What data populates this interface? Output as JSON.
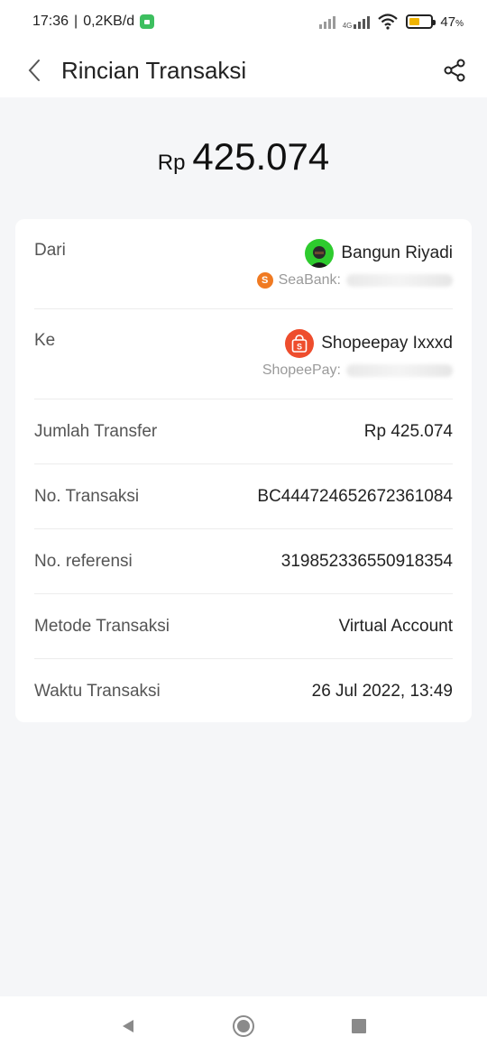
{
  "status_bar": {
    "time": "17:36",
    "separator": "|",
    "speed": "0,2KB/d",
    "net_label": "4G",
    "battery_percent": "47",
    "battery_percent_sign": "%",
    "battery_level": 0.47
  },
  "app_bar": {
    "title": "Rincian Transaksi",
    "back_icon": "chevron-left-icon",
    "share_icon": "share-icon"
  },
  "amount": {
    "currency": "Rp",
    "value": "425.074"
  },
  "details": {
    "from": {
      "label": "Dari",
      "name": "Bangun Riyadi",
      "account_label": "SeaBank:",
      "account_icon": "seabank-icon"
    },
    "to": {
      "label": "Ke",
      "name": "Shopeepay Ixxxd",
      "account_label": "ShopeePay:",
      "account_icon": "shopee-icon"
    },
    "rows": [
      {
        "label": "Jumlah Transfer",
        "value": "Rp 425.074"
      },
      {
        "label": "No. Transaksi",
        "value": "BC444724652672361084"
      },
      {
        "label": "No. referensi",
        "value": "319852336550918354"
      },
      {
        "label": "Metode Transaksi",
        "value": "Virtual Account"
      },
      {
        "label": "Waktu Transaksi",
        "value": "26 Jul 2022, 13:49"
      }
    ]
  },
  "nav_bar": {
    "back": "triangle-back-icon",
    "home": "circle-home-icon",
    "recents": "square-recents-icon"
  },
  "colors": {
    "background": "#f5f6f8",
    "card": "#ffffff",
    "shopee_orange": "#ee4d2d",
    "seabank_orange": "#f07a22",
    "avatar_green": "#2ecb2e"
  }
}
